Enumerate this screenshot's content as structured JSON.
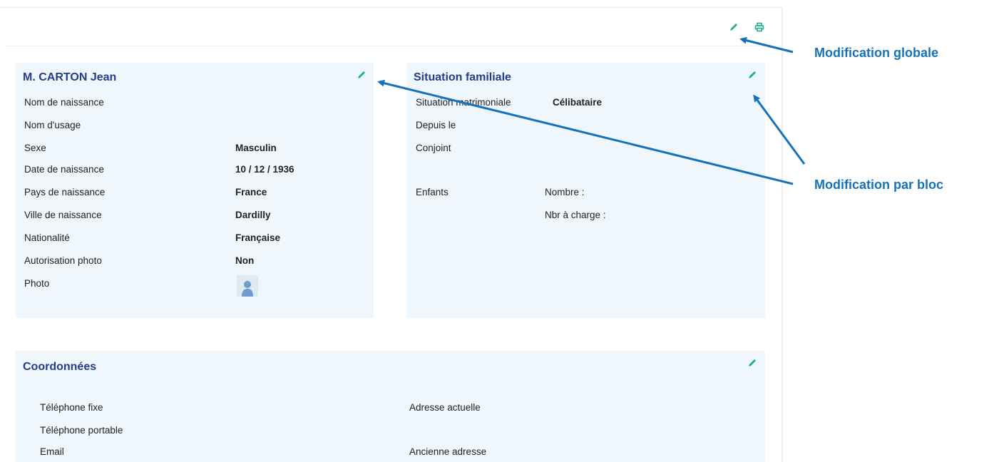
{
  "colors": {
    "accent_green": "#1fb28a",
    "title_blue": "#243d8a",
    "annotation_blue": "#1672b8",
    "card_bg": "#eff6fc"
  },
  "toolbar": {
    "edit_icon": "pencil-icon",
    "print_icon": "printer-icon"
  },
  "identity": {
    "title": "M. CARTON Jean",
    "rows": [
      {
        "label": "Nom de naissance",
        "value": ""
      },
      {
        "label": "Nom d'usage",
        "value": ""
      },
      {
        "label": "Sexe",
        "value": "Masculin"
      },
      {
        "label": "Date de naissance",
        "value": "10 / 12 / 1936"
      },
      {
        "label": "Pays de naissance",
        "value": "France"
      },
      {
        "label": "Ville de naissance",
        "value": "Dardilly"
      },
      {
        "label": "Nationalité",
        "value": "Française"
      },
      {
        "label": "Autorisation photo",
        "value": "Non"
      },
      {
        "label": "Photo",
        "value": ""
      }
    ],
    "photo_icon": "user-silhouette-icon"
  },
  "family": {
    "title": "Situation familiale",
    "marital_label": "Situation matrimoniale",
    "marital_value": "Célibataire",
    "since_label": "Depuis le",
    "spouse_label": "Conjoint",
    "children_label": "Enfants",
    "count_label": "Nombre :",
    "dependents_label": "Nbr à charge :"
  },
  "contact": {
    "title": "Coordonnées",
    "landline_label": "Téléphone fixe",
    "mobile_label": "Téléphone portable",
    "email_label": "Email",
    "current_address_label": "Adresse actuelle",
    "old_address_label": "Ancienne adresse"
  },
  "annotations": {
    "global": "Modification globale",
    "block": "Modification par bloc"
  }
}
